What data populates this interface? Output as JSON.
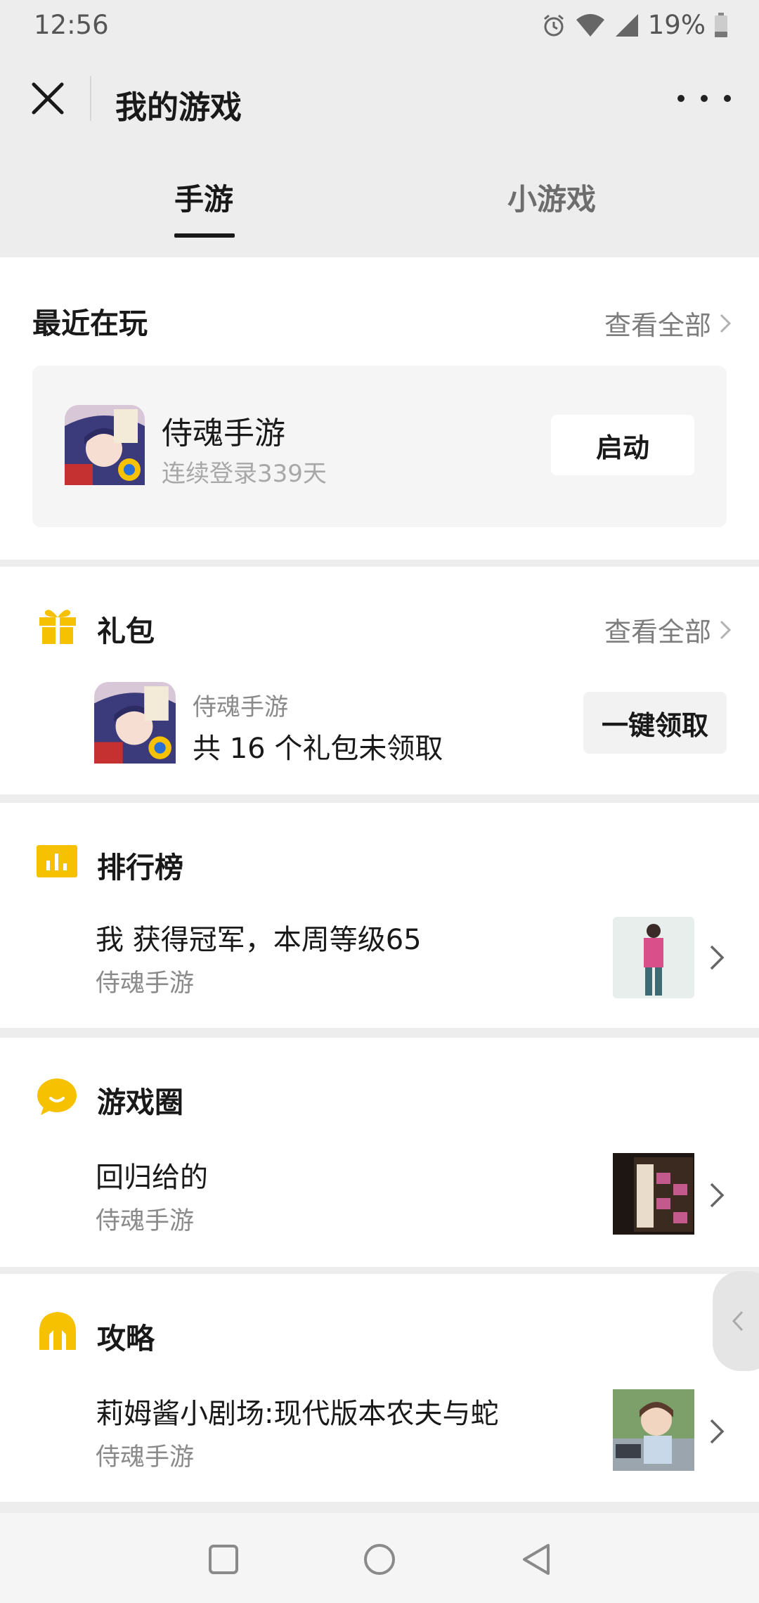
{
  "status_bar": {
    "time": "12:56",
    "battery": "19%"
  },
  "header": {
    "title": "我的游戏"
  },
  "tabs": [
    {
      "label": "手游",
      "active": true
    },
    {
      "label": "小游戏",
      "active": false
    }
  ],
  "recent": {
    "title": "最近在玩",
    "view_all": "查看全部",
    "game": {
      "name": "侍魂手游",
      "subtitle": "连续登录339天",
      "button": "启动"
    }
  },
  "gifts": {
    "title": "礼包",
    "view_all": "查看全部",
    "item": {
      "game": "侍魂手游",
      "desc": "共 16 个礼包未领取",
      "button": "一键领取"
    }
  },
  "rank": {
    "title": "排行榜",
    "item": {
      "title": "我 获得冠军，本周等级65",
      "sub": "侍魂手游"
    }
  },
  "circle": {
    "title": "游戏圈",
    "item": {
      "title": "回归给的",
      "sub": "侍魂手游"
    }
  },
  "guide": {
    "title": "攻略",
    "item": {
      "title": "莉姆酱小剧场:现代版本农夫与蛇",
      "sub": "侍魂手游"
    }
  },
  "colors": {
    "accent": "#f5c100",
    "background": "#ededed"
  },
  "icons": [
    "close-icon",
    "more-icon",
    "gift-icon",
    "bar-chart-icon",
    "chat-bubble-icon",
    "helmet-icon",
    "chevron-right-icon",
    "chevron-left-icon"
  ]
}
